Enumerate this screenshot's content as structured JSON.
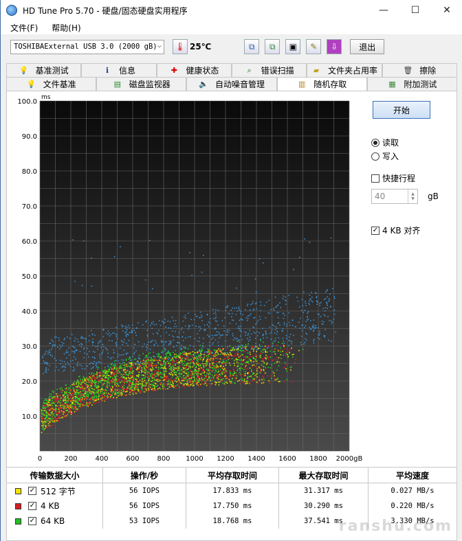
{
  "window": {
    "title": "HD Tune Pro 5.70 - 硬盘/固态硬盘实用程序",
    "minimize": "—",
    "maximize": "☐",
    "close": "✕"
  },
  "menu": {
    "file": "文件(F)",
    "help": "帮助(H)"
  },
  "toolbar": {
    "drive": "TOSHIBAExternal USB 3.0 (2000 gB)",
    "temperature": "25℃",
    "exit_label": "退出"
  },
  "tabs_row1": [
    {
      "label": "基准测试",
      "icon": "lightbulb-icon"
    },
    {
      "label": "信息",
      "icon": "info-icon"
    },
    {
      "label": "健康状态",
      "icon": "health-cross-icon"
    },
    {
      "label": "错误扫描",
      "icon": "magnifier-icon"
    },
    {
      "label": "文件夹占用率",
      "icon": "folder-icon"
    },
    {
      "label": "擦除",
      "icon": "trash-icon"
    }
  ],
  "tabs_row2": [
    {
      "label": "文件基准",
      "icon": "lightbulb-icon",
      "active": false
    },
    {
      "label": "磁盘监视器",
      "icon": "monitor-icon",
      "active": false
    },
    {
      "label": "自动噪音管理",
      "icon": "speaker-icon",
      "active": false
    },
    {
      "label": "随机存取",
      "icon": "lock-icon",
      "active": true
    },
    {
      "label": "附加测试",
      "icon": "calendar-icon",
      "active": false
    }
  ],
  "controls": {
    "start_label": "开始",
    "read_label": "读取",
    "write_label": "写入",
    "quick_label": "快捷行程",
    "quick_value": "40",
    "quick_unit": "gB",
    "align_label": "4 KB 对齐",
    "read_selected": true,
    "quick_checked": false,
    "align_checked": true
  },
  "chart_data": {
    "type": "scatter",
    "ylabel": "ms",
    "xunit": "gB",
    "xlim": [
      0,
      2000
    ],
    "ylim": [
      0,
      100
    ],
    "yticks": [
      "100.0",
      "90.0",
      "80.0",
      "70.0",
      "60.0",
      "50.0",
      "40.0",
      "30.0",
      "20.0",
      "10.0"
    ],
    "xticks": [
      "0",
      "200",
      "400",
      "600",
      "800",
      "1000",
      "1200",
      "1400",
      "1600",
      "1800",
      "2000gB"
    ],
    "grid": true,
    "background": "#222222",
    "series": [
      {
        "name": "512 字节",
        "color": "#e8e800",
        "approx_mean_ms": 17.8,
        "approx_range_ms": [
          5,
          31
        ]
      },
      {
        "name": "4 KB",
        "color": "#e02020",
        "approx_mean_ms": 17.75,
        "approx_range_ms": [
          5,
          30
        ]
      },
      {
        "name": "64 KB",
        "color": "#20d020",
        "approx_mean_ms": 18.8,
        "approx_range_ms": [
          5,
          38
        ]
      }
    ],
    "upper_band": {
      "color": "#3a8fd0",
      "approx_range_ms": [
        20,
        45
      ]
    }
  },
  "table": {
    "headers": [
      "传输数据大小",
      "操作/秒",
      "平均存取时间",
      "最大存取时间",
      "平均速度"
    ],
    "rows": [
      {
        "swatch": "#f2e600",
        "size": "512 字节",
        "iops": "56 IOPS",
        "avg": "17.833 ms",
        "max": "31.317 ms",
        "speed": "0.027 MB/s"
      },
      {
        "swatch": "#d42020",
        "size": "4 KB",
        "iops": "56 IOPS",
        "avg": "17.750 ms",
        "max": "30.290 ms",
        "speed": "0.220 MB/s"
      },
      {
        "swatch": "#20c020",
        "size": "64 KB",
        "iops": "53 IOPS",
        "avg": "18.768 ms",
        "max": "37.541 ms",
        "speed": "3.330 MB/s"
      }
    ]
  }
}
